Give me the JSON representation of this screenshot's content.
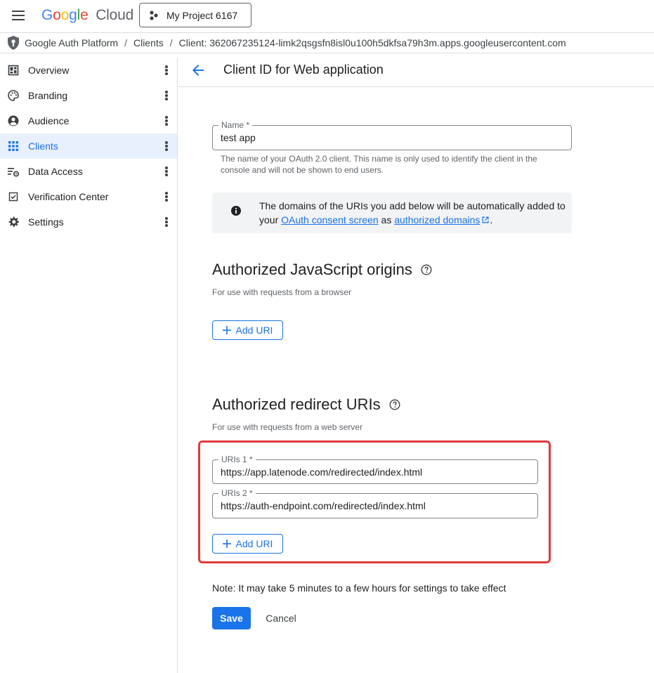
{
  "topbar": {
    "logo_letters": [
      "G",
      "o",
      "o",
      "g",
      "l",
      "e"
    ],
    "logo_colors": [
      "#4285F4",
      "#EA4335",
      "#FBBC05",
      "#4285F4",
      "#34A853",
      "#EA4335"
    ],
    "logo_suffix": "Cloud",
    "project": "My Project 6167",
    "menu_icon": "hamburger-menu-icon",
    "project_icon": "project-dots-icon"
  },
  "breadcrumb": {
    "items": [
      "Google Auth Platform",
      "Clients",
      "Client: 362067235124-limk2qsgsfn8isl0u100h5dkfsa79h3m.apps.googleusercontent.com"
    ],
    "separator": "/"
  },
  "sidebar": {
    "items": [
      {
        "label": "Overview",
        "icon": "dashboard-icon",
        "active": false
      },
      {
        "label": "Branding",
        "icon": "palette-icon",
        "active": false
      },
      {
        "label": "Audience",
        "icon": "account-circle-icon",
        "active": false
      },
      {
        "label": "Clients",
        "icon": "grid-icon",
        "active": true
      },
      {
        "label": "Data Access",
        "icon": "data-settings-icon",
        "active": false
      },
      {
        "label": "Verification Center",
        "icon": "verified-checkbox-icon",
        "active": false
      },
      {
        "label": "Settings",
        "icon": "gear-icon",
        "active": false
      }
    ]
  },
  "header": {
    "title": "Client ID for Web application"
  },
  "form": {
    "name_label": "Name *",
    "name_value": "test app",
    "name_hint_line1": "The name of your OAuth 2.0 client. This name is only used to identify the client in the",
    "name_hint_line2": "console and will not be shown to end users.",
    "info_text_1": "The domains of the URIs you add below will be automatically added to your ",
    "info_link_1": "OAuth consent screen",
    "info_text_2": " as ",
    "info_link_2": "authorized domains",
    "info_text_3": "."
  },
  "js_origins": {
    "title": "Authorized JavaScript origins",
    "subtitle": "For use with requests from a browser",
    "add_label": "Add URI"
  },
  "redirect": {
    "title": "Authorized redirect URIs",
    "subtitle": "For use with requests from a web server",
    "uris": [
      {
        "label": "URIs 1 *",
        "value": "https://app.latenode.com/redirected/index.html"
      },
      {
        "label": "URIs 2 *",
        "value": "https://auth-endpoint.com/redirected/index.html"
      }
    ],
    "add_label": "Add URI"
  },
  "footer": {
    "note": "Note: It may take 5 minutes to a few hours for settings to take effect",
    "save": "Save",
    "cancel": "Cancel"
  },
  "colors": {
    "primary": "#1a73e8",
    "highlight": "#e03b3b",
    "active_bg": "#e8f0fe"
  }
}
